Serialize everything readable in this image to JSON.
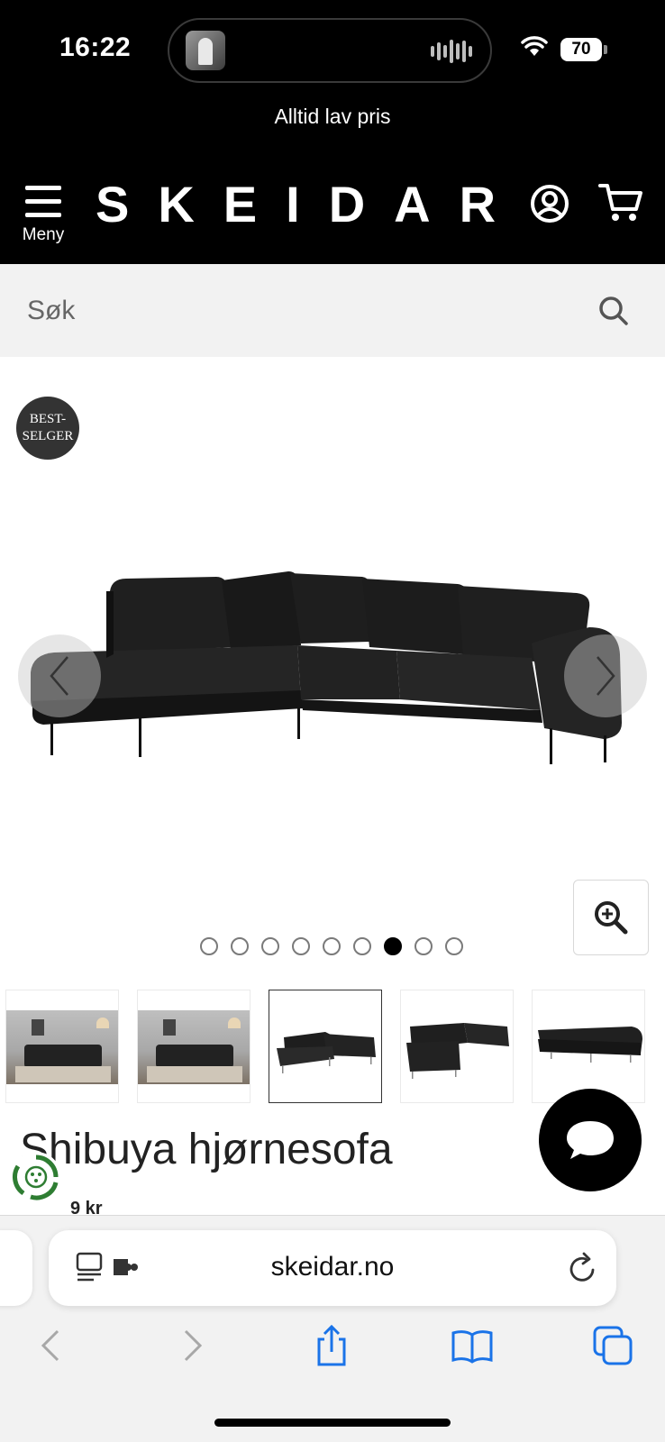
{
  "status_bar": {
    "time": "16:22",
    "battery": "70",
    "icons": [
      "now-playing-art",
      "audio-waveform-icon",
      "wifi-icon",
      "battery-icon"
    ]
  },
  "promo": {
    "text": "Alltid lav pris"
  },
  "header": {
    "menu_label": "Meny",
    "logo": "SKEIDAR",
    "icons": [
      "hamburger-icon",
      "account-icon",
      "cart-icon"
    ]
  },
  "search": {
    "placeholder": "Søk"
  },
  "gallery": {
    "badge_line1": "BEST-",
    "badge_line2": "SELGER",
    "dot_count": 9,
    "active_dot": 6,
    "thumbnails": [
      "room-photo",
      "room-photo",
      "sofa-corner-left",
      "sofa-corner-right",
      "sofa-side"
    ],
    "selected_thumbnail": 2
  },
  "product": {
    "title": "Shibuya hjørnesofa",
    "price_partial": "9 kr"
  },
  "browser": {
    "url": "skeidar.no",
    "toolbar": [
      "back-icon",
      "forward-icon",
      "share-icon",
      "bookmarks-icon",
      "tabs-icon"
    ]
  },
  "colors": {
    "header_bg": "#000000",
    "search_bg": "#f2f2f2",
    "accent_link": "#1a73e8",
    "badge_bg": "#333333",
    "eco_green": "#2e7d32"
  }
}
